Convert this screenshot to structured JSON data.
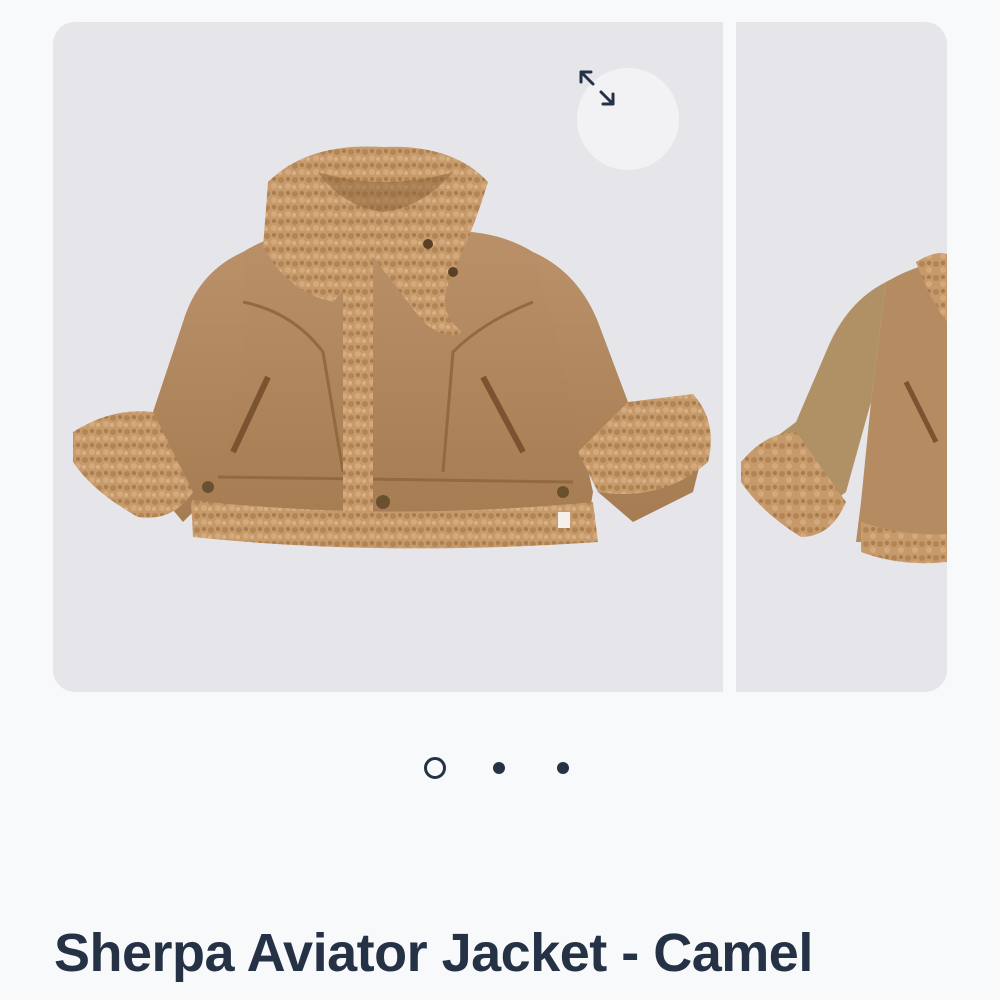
{
  "product": {
    "title": "Sherpa Aviator Jacket - Camel",
    "colors": {
      "text": "#253246",
      "image_bg": "#e6e6ea",
      "jacket_suede": "#b58c62",
      "jacket_sherpa": "#c79a6c"
    }
  },
  "gallery": {
    "expand_icon": "expand-arrows-icon",
    "slide_count": 3,
    "active_slide": 1
  }
}
